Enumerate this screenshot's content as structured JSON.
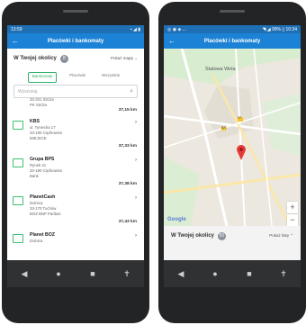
{
  "left": {
    "status": {
      "time": "13:59",
      "icons": "▪ ◢ ▮"
    },
    "appbar": {
      "title": "Placówki i bankomaty",
      "back": "←"
    },
    "nearby": {
      "title": "W Twojej okolicy",
      "count": "8",
      "toggle": "Pokaż mapę ⌄"
    },
    "filters": [
      "Bankomaty",
      "Placówki",
      "Wszystkie"
    ],
    "search": {
      "placeholder": "Wyszukaj",
      "icon": "⌕"
    },
    "items": [
      {
        "name": "",
        "lines": [
          "33-331 Stróże",
          "PK Stróże"
        ],
        "dist": "37,15 km",
        "chev": ""
      },
      {
        "name": "KBS",
        "lines": [
          "ul. Tyniecka 17",
          "33-190 Ciężkowice",
          "MIEJSCE"
        ],
        "dist": "37,33 km",
        "chev": "›"
      },
      {
        "name": "Grupa BPS",
        "lines": [
          "Rynek 21",
          "33-190 Ciężkowice",
          "Bank"
        ],
        "dist": "37,38 km",
        "chev": "›"
      },
      {
        "name": "PlanetCash",
        "lines": [
          "Dolnica",
          "33-170 Tuchów",
          "BOZ BNP Paribas"
        ],
        "dist": "37,43 km",
        "chev": "›"
      },
      {
        "name": "Planet BOZ",
        "lines": [
          "Dolnica"
        ],
        "dist": "",
        "chev": "›"
      }
    ],
    "nav": [
      "◀",
      "●",
      "■",
      "✝"
    ]
  },
  "right": {
    "status": {
      "left": "◎ ◉ ◈ ...",
      "right": "◥ ◢ 99% ▯ 10:34"
    },
    "appbar": {
      "title": "Placówki i bankomaty",
      "back": "←"
    },
    "map": {
      "city": "Stalowa Wola",
      "road_a": "871",
      "road_b": "77",
      "google": "Google",
      "zoom_in": "+",
      "zoom_out": "−"
    },
    "nearby": {
      "title": "W Twojej okolicy",
      "count": "50",
      "toggle": "Pokaż listę ⌃"
    },
    "nav": [
      "◀",
      "●",
      "■",
      "✝"
    ]
  }
}
